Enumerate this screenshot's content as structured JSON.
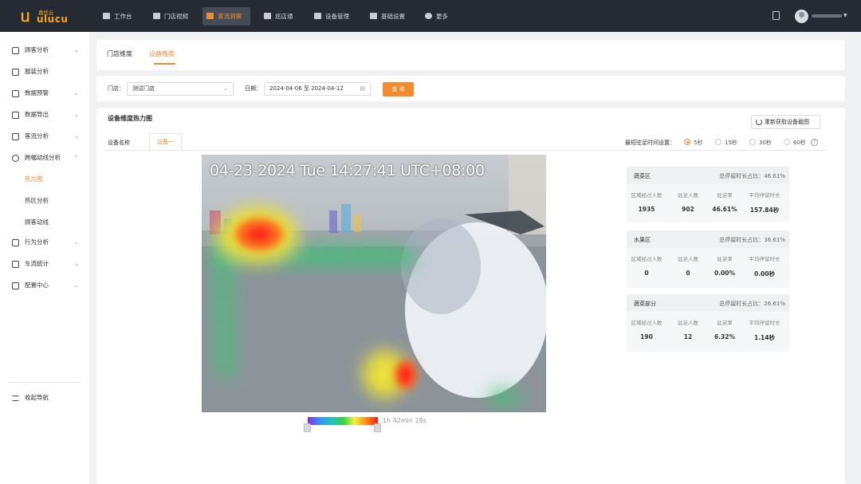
{
  "brand": {
    "cn": "嘉优云",
    "en": "ulucu"
  },
  "nav": [
    {
      "label": "工作台",
      "icon": "home-icon"
    },
    {
      "label": "门店视频",
      "icon": "video-icon"
    },
    {
      "label": "客流洞察",
      "icon": "user-icon"
    },
    {
      "label": "巡店通",
      "icon": "check-icon"
    },
    {
      "label": "设备管理",
      "icon": "device-icon"
    },
    {
      "label": "基础设置",
      "icon": "settings-icon"
    },
    {
      "label": "更多",
      "icon": "more-icon"
    }
  ],
  "nav_active": "客流洞察",
  "sidebar": {
    "items": [
      {
        "label": "顾客分析",
        "chevron": "⌄"
      },
      {
        "label": "服装分析",
        "chevron": ""
      },
      {
        "label": "数据预警",
        "chevron": "⌄"
      },
      {
        "label": "数据导出",
        "chevron": "⌄"
      },
      {
        "label": "客流分析",
        "chevron": "⌄"
      },
      {
        "label": "跨幅动线分析",
        "chevron": "⌃"
      },
      {
        "label": "热力图",
        "chevron": ""
      },
      {
        "label": "热区分析",
        "chevron": ""
      },
      {
        "label": "顾客动线",
        "chevron": ""
      },
      {
        "label": "行为分析",
        "chevron": "⌄"
      },
      {
        "label": "车流统计",
        "chevron": "⌄"
      },
      {
        "label": "配置中心",
        "chevron": "⌄"
      }
    ],
    "collapse": "收起导航"
  },
  "tabs": {
    "store": "门店维度",
    "device": "设备维度"
  },
  "filter": {
    "store_label": "门店：",
    "store_value": "测试门店",
    "date_label": "日期：",
    "date_value": "2024-04-06 至 2024-04-12",
    "query": "查 询"
  },
  "heatmap": {
    "title": "设备维度热力图",
    "refresh": "重新获取设备截图",
    "device_name_label": "设备名称",
    "device_tab": "设备一",
    "dwell_label": "最短驻足时间设置：",
    "dwell_options": [
      "5秒",
      "15秒",
      "30秒",
      "60秒"
    ],
    "dwell_selected": "5秒",
    "timestamp": "04-23-2024 Tue 14:27:41 UTC+08:00",
    "legend_max": "1h 42min 18s",
    "help": "?"
  },
  "zones": [
    {
      "name": "蔬菜区",
      "ratio": "总停留时长占比：46.61%",
      "cols": [
        "区域经过人数",
        "驻足人数",
        "驻足率",
        "平均停留时长"
      ],
      "vals": [
        "1935",
        "902",
        "46.61%",
        "157.84秒"
      ]
    },
    {
      "name": "水果区",
      "ratio": "总停留时长占比：36.61%",
      "cols": [
        "区域经过人数",
        "驻足人数",
        "驻足率",
        "平均停留时长"
      ],
      "vals": [
        "0",
        "0",
        "0.00%",
        "0.00秒"
      ]
    },
    {
      "name": "蔬菜部分",
      "ratio": "总停留时长占比：26.61%",
      "cols": [
        "区域经过人数",
        "驻足人数",
        "驻足率",
        "平均停留时长"
      ],
      "vals": [
        "190",
        "12",
        "6.32%",
        "1.14秒"
      ]
    }
  ]
}
